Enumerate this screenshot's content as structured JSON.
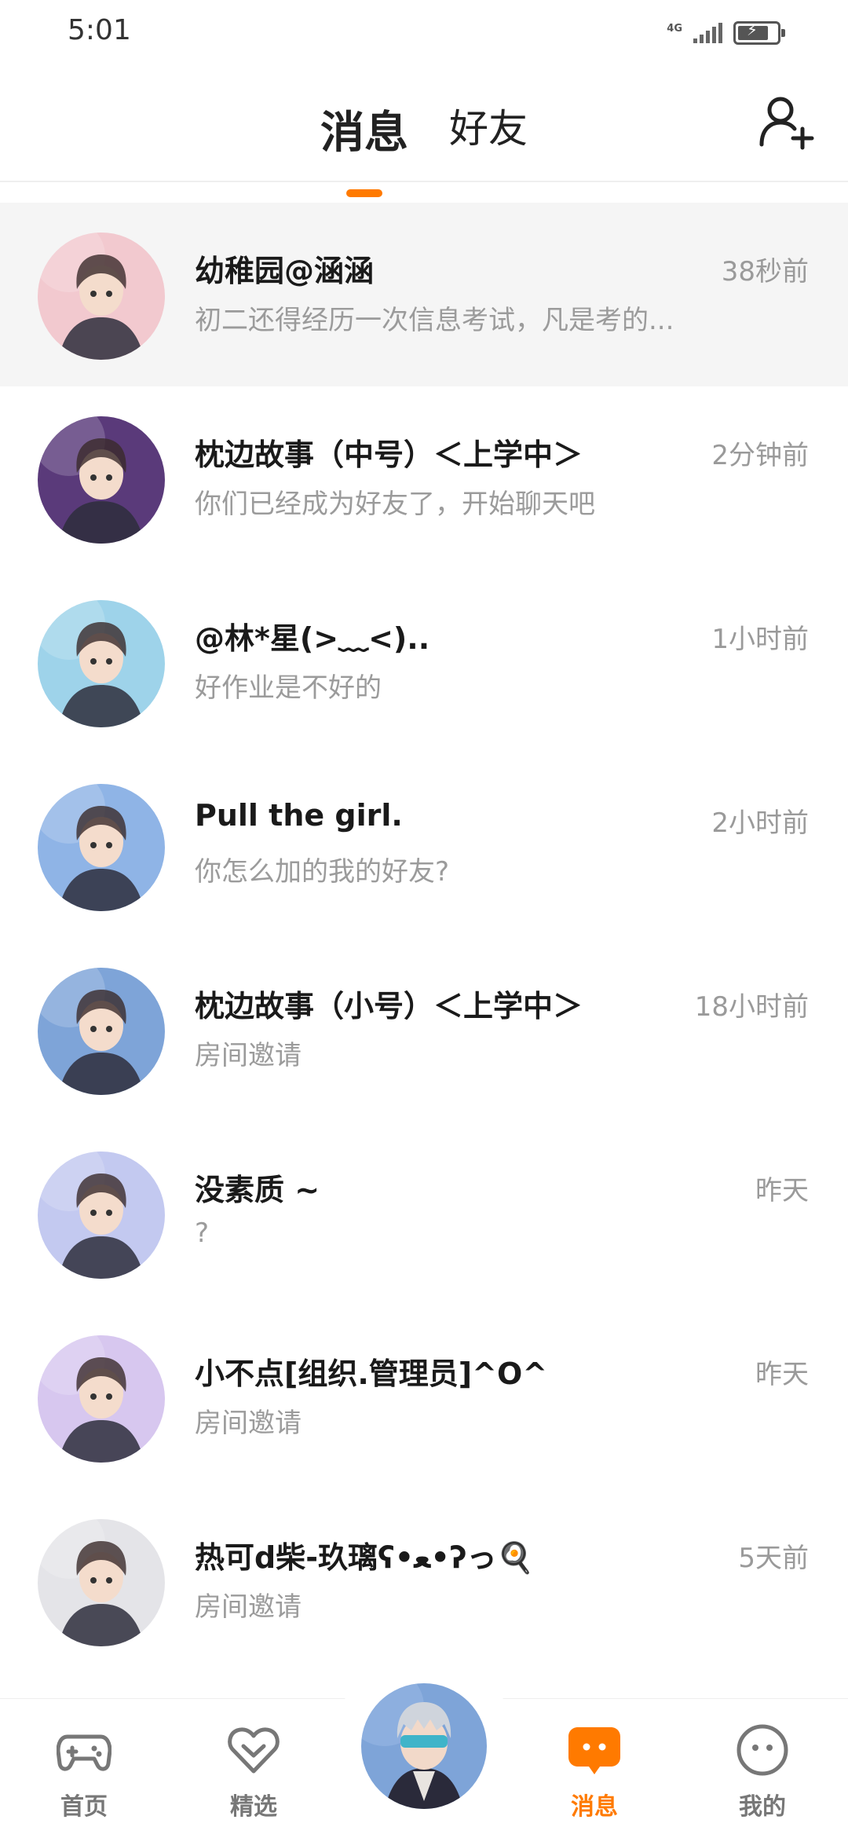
{
  "status_bar": {
    "time": "5:01",
    "network": "4G",
    "battery_level": 0.8,
    "charging": true
  },
  "header": {
    "tabs": [
      {
        "label": "消息",
        "active": true
      },
      {
        "label": "好友",
        "active": false
      }
    ],
    "add_friend_icon": "add-user-icon",
    "accent_color": "#ff7a00"
  },
  "conversations": [
    {
      "name": "幼稚园@涵涵",
      "time": "38秒前",
      "preview": "初二还得经历一次信息考试，凡是考的...",
      "highlighted": true,
      "avatar_color": "#f2c9cf"
    },
    {
      "name": "枕边故事（中号）＜上学中＞",
      "time": "2分钟前",
      "preview": "你们已经成为好友了，开始聊天吧",
      "highlighted": false,
      "avatar_color": "#5a3a7a"
    },
    {
      "name": "@林*星(>﹏<)..",
      "time": "1小时前",
      "preview": "好作业是不好的",
      "highlighted": false,
      "avatar_color": "#9ed3ea"
    },
    {
      "name": "Pull the girl.",
      "time": "2小时前",
      "preview": "你怎么加的我的好友?",
      "highlighted": false,
      "avatar_color": "#8fb4e6"
    },
    {
      "name": "枕边故事（小号）＜上学中＞",
      "time": "18小时前",
      "preview": "房间邀请",
      "highlighted": false,
      "avatar_color": "#7ea4d8"
    },
    {
      "name": "没素质 ~",
      "time": "昨天",
      "preview": "?",
      "highlighted": false,
      "avatar_color": "#c3c9f0"
    },
    {
      "name": "小不点[组织.管理员]^O^",
      "time": "昨天",
      "preview": "房间邀请",
      "highlighted": false,
      "avatar_color": "#d7c7ef"
    },
    {
      "name": "热可d柴-玖璃ʕ•ﻌ•ʔっ🍳",
      "time": "5天前",
      "preview": "房间邀请",
      "highlighted": false,
      "avatar_color": "#e4e4e8"
    }
  ],
  "bottom_nav": {
    "items": [
      {
        "label": "首页",
        "icon": "gamepad-icon",
        "active": false
      },
      {
        "label": "精选",
        "icon": "heart-gem-icon",
        "active": false
      },
      {
        "label": "消息",
        "icon": "chat-bubble-icon",
        "active": true
      },
      {
        "label": "我的",
        "icon": "smiley-face-icon",
        "active": false
      }
    ],
    "center_avatar_color": "#7ea4d8"
  }
}
